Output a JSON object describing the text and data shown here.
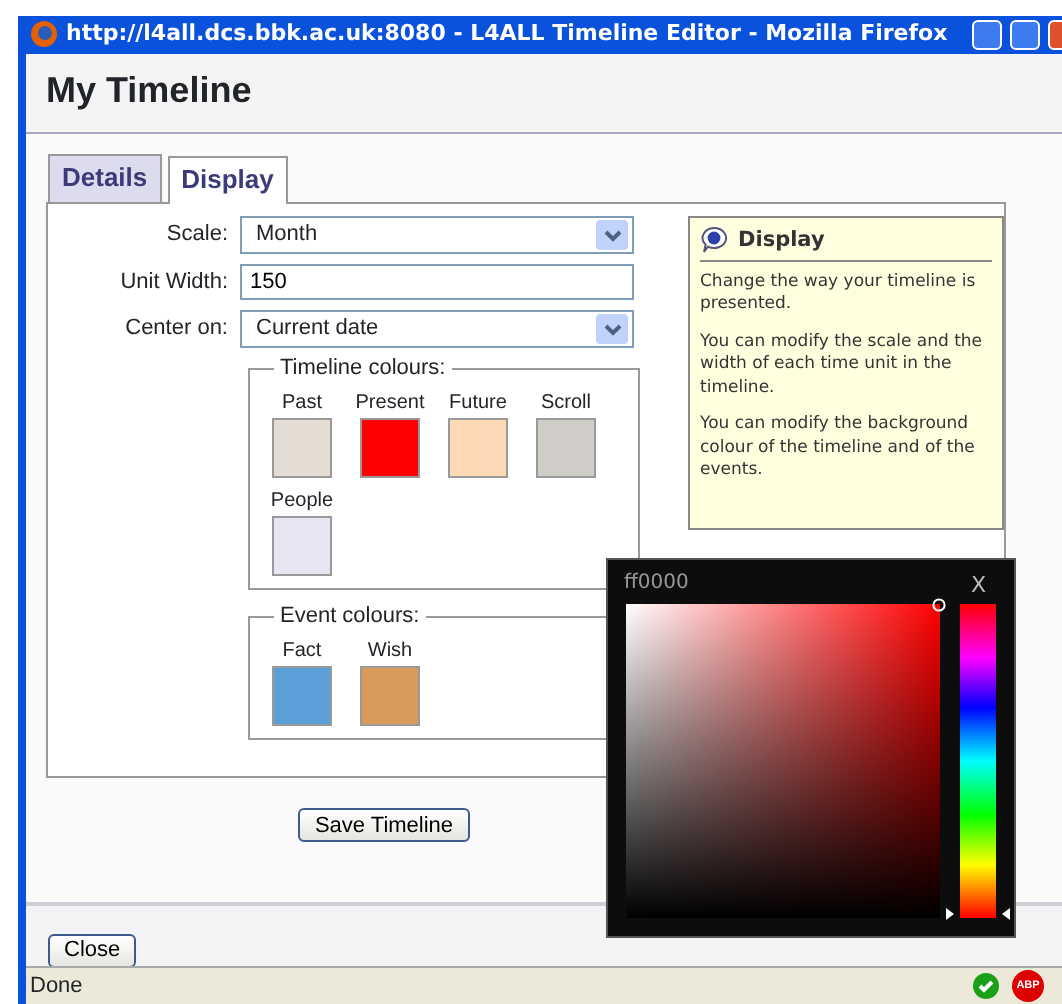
{
  "window": {
    "title": "http://l4all.dcs.bbk.ac.uk:8080 - L4ALL Timeline Editor - Mozilla Firefox"
  },
  "page_title": "My Timeline",
  "tabs": [
    {
      "label": "Details",
      "selected": false
    },
    {
      "label": "Display",
      "selected": true
    }
  ],
  "form": [
    {
      "kind": "select",
      "label": "Scale:",
      "value": "Month"
    },
    {
      "kind": "input",
      "label": "Unit Width:",
      "value": "150"
    },
    {
      "kind": "select",
      "label": "Center on:",
      "value": "Current date"
    }
  ],
  "timeline_colours": {
    "legend": "Timeline colours:",
    "swatches": [
      {
        "label": "Past",
        "color": "#e5ddd4"
      },
      {
        "label": "Present",
        "color": "#ff0000"
      },
      {
        "label": "Future",
        "color": "#fdd9b6"
      },
      {
        "label": "Scroll",
        "color": "#d0cdc8"
      },
      {
        "label": "People",
        "color": "#e7e7f3"
      }
    ]
  },
  "event_colours": {
    "legend": "Event colours:",
    "swatches": [
      {
        "label": "Fact",
        "color": "#5a9fd8"
      },
      {
        "label": "Wish",
        "color": "#d99a5a"
      }
    ]
  },
  "help": {
    "title": "Display",
    "paragraphs": [
      "Change the way your timeline is presented.",
      "You can modify the scale and the width of each time unit in the timeline.",
      "You can modify the background colour of the timeline and of the events."
    ]
  },
  "save_button": "Save Timeline",
  "color_picker": {
    "hex": "ff0000",
    "close": "X"
  },
  "close_button": "Close",
  "status_bar": {
    "text": "Done",
    "adblock": "ABP"
  }
}
